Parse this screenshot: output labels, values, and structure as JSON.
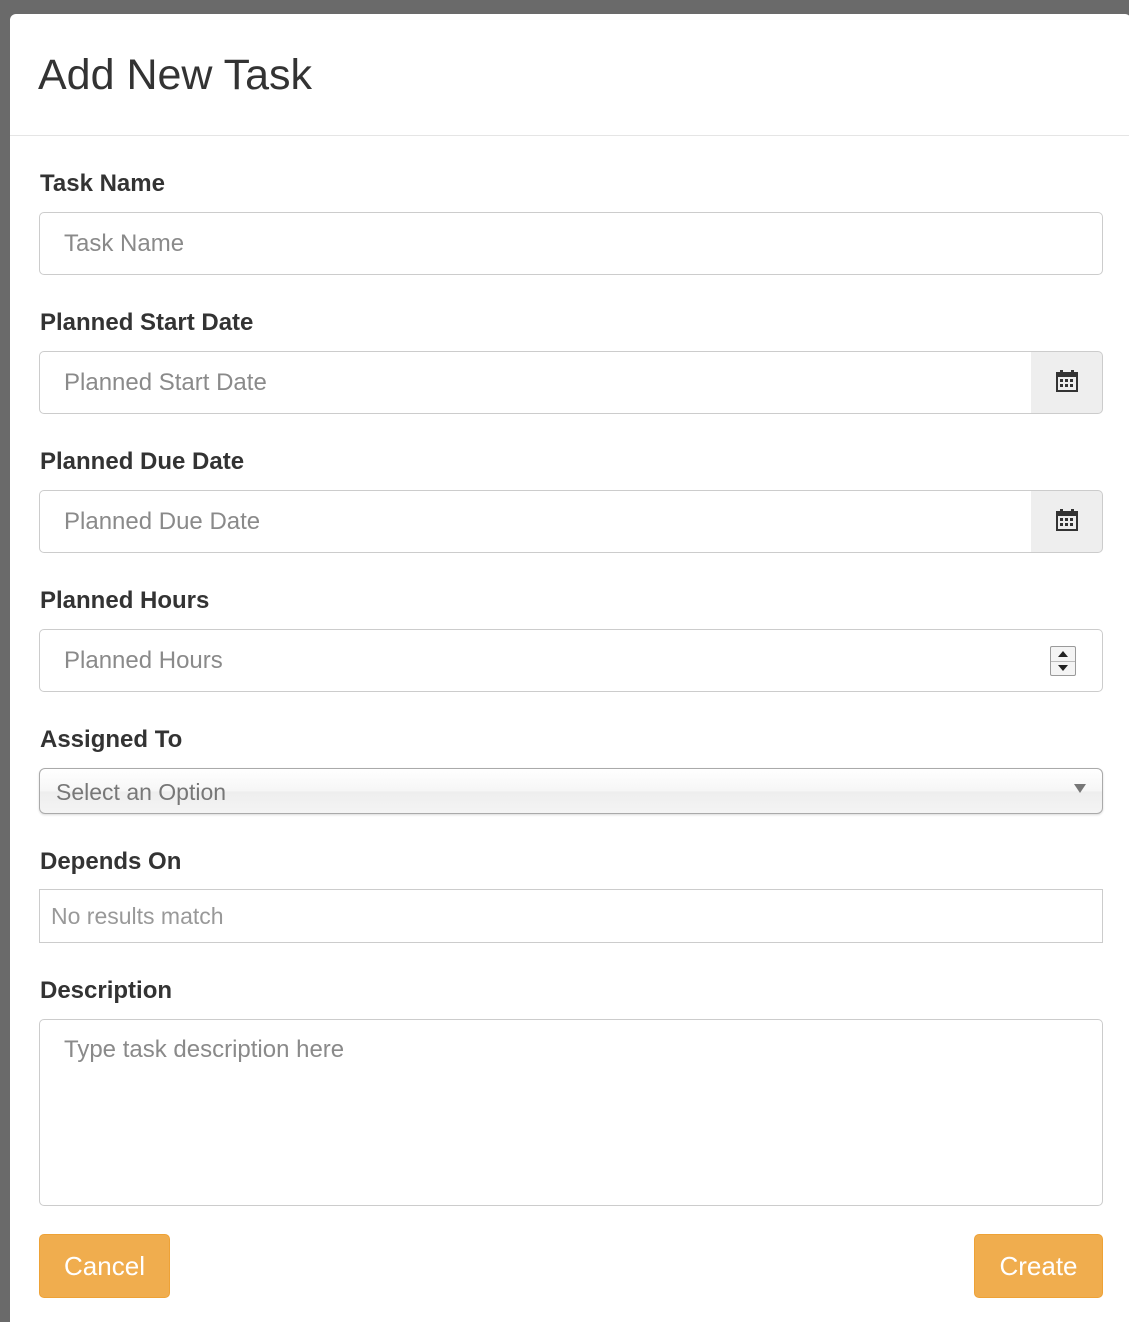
{
  "modal": {
    "title": "Add New Task"
  },
  "fields": {
    "task_name": {
      "label": "Task Name",
      "placeholder": "Task Name",
      "value": ""
    },
    "start_date": {
      "label": "Planned Start Date",
      "placeholder": "Planned Start Date",
      "value": "",
      "icon": "calendar-icon"
    },
    "due_date": {
      "label": "Planned Due Date",
      "placeholder": "Planned Due Date",
      "value": "",
      "icon": "calendar-icon"
    },
    "planned_hours": {
      "label": "Planned Hours",
      "placeholder": "Planned Hours",
      "value": ""
    },
    "assigned_to": {
      "label": "Assigned To",
      "selected": "Select an Option"
    },
    "depends_on": {
      "label": "Depends On",
      "text": "No results match"
    },
    "description": {
      "label": "Description",
      "placeholder": "Type task description here",
      "value": ""
    }
  },
  "buttons": {
    "cancel": "Cancel",
    "create": "Create"
  },
  "colors": {
    "accent": "#f0ad4e",
    "backdrop": "#6a6a6a"
  }
}
